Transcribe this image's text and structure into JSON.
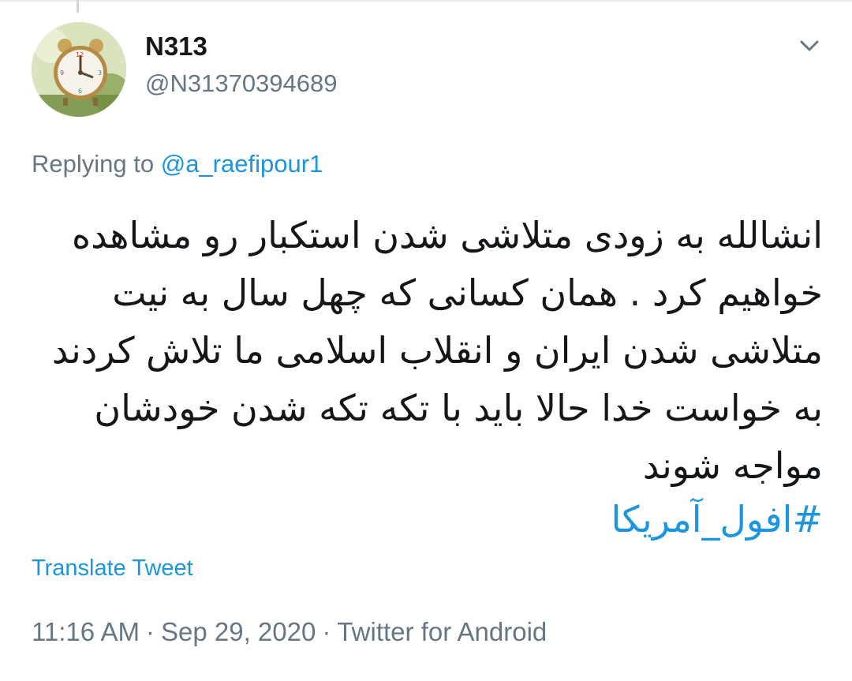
{
  "tweet": {
    "display_name": "N313",
    "handle": "@N31370394689",
    "replying_prefix": "Replying to",
    "replying_to": "@a_raefipour1",
    "text": "انشالله به زودی متلاشی شدن استکبار رو مشاهده خواهیم کرد . همان کسانی که چهل سال به نیت متلاشی شدن ایران و انقلاب اسلامی ما تلاش کردند به خواست خدا حالا باید با تکه تکه شدن خودشان مواجه شوند",
    "hashtag": "#افول_آمریکا",
    "translate_label": "Translate Tweet",
    "time": "11:16 AM",
    "date": "Sep 29, 2020",
    "source": "Twitter for Android",
    "separator": "·"
  },
  "icons": {
    "avatar": "alarm-clock-avatar",
    "menu": "chevron-down-icon"
  },
  "colors": {
    "link": "#1b95e0",
    "secondary_text": "#657786",
    "primary_text": "#14171a"
  }
}
